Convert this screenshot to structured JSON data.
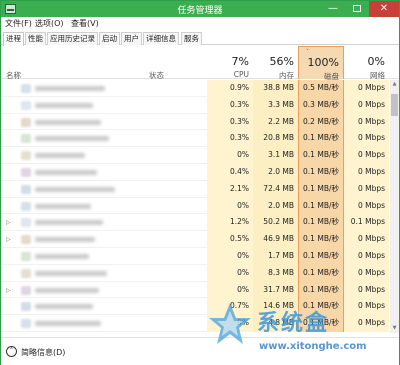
{
  "window": {
    "title": "任务管理器"
  },
  "window_controls": {
    "minimize": "—",
    "close": "✕"
  },
  "menu": {
    "items": [
      "文件(F)",
      "选项(O)",
      "查看(V)"
    ]
  },
  "tabs": [
    {
      "label": "进程",
      "active": true
    },
    {
      "label": "性能",
      "active": false
    },
    {
      "label": "应用历史记录",
      "active": false
    },
    {
      "label": "启动",
      "active": false
    },
    {
      "label": "用户",
      "active": false
    },
    {
      "label": "详细信息",
      "active": false
    },
    {
      "label": "服务",
      "active": false
    }
  ],
  "columns": {
    "name": "名称",
    "status": "状态",
    "cpu": {
      "percent": "7%",
      "label": "CPU"
    },
    "memory": {
      "percent": "56%",
      "label": "内存"
    },
    "disk": {
      "percent": "100%",
      "label": "磁盘"
    },
    "network": {
      "percent": "0%",
      "label": "网络"
    }
  },
  "rows": [
    {
      "expandable": false,
      "cpu": "0.9%",
      "memory": "38.8 MB",
      "disk": "0.5 MB/秒",
      "network": "0 Mbps"
    },
    {
      "expandable": false,
      "cpu": "0.3%",
      "memory": "3.3 MB",
      "disk": "0.3 MB/秒",
      "network": "0 Mbps"
    },
    {
      "expandable": false,
      "cpu": "0.3%",
      "memory": "2.2 MB",
      "disk": "0.2 MB/秒",
      "network": "0 Mbps"
    },
    {
      "expandable": false,
      "cpu": "0.3%",
      "memory": "20.8 MB",
      "disk": "0.1 MB/秒",
      "network": "0 Mbps"
    },
    {
      "expandable": false,
      "cpu": "0%",
      "memory": "3.1 MB",
      "disk": "0.1 MB/秒",
      "network": "0 Mbps"
    },
    {
      "expandable": false,
      "cpu": "0.4%",
      "memory": "2.0 MB",
      "disk": "0.1 MB/秒",
      "network": "0 Mbps"
    },
    {
      "expandable": false,
      "cpu": "2.1%",
      "memory": "72.4 MB",
      "disk": "0.1 MB/秒",
      "network": "0 Mbps"
    },
    {
      "expandable": false,
      "cpu": "0%",
      "memory": "2.0 MB",
      "disk": "0.1 MB/秒",
      "network": "0 Mbps"
    },
    {
      "expandable": true,
      "cpu": "1.2%",
      "memory": "50.2 MB",
      "disk": "0.1 MB/秒",
      "network": "0.1 Mbps"
    },
    {
      "expandable": true,
      "cpu": "0.5%",
      "memory": "46.9 MB",
      "disk": "0.1 MB/秒",
      "network": "0 Mbps"
    },
    {
      "expandable": false,
      "cpu": "0%",
      "memory": "1.7 MB",
      "disk": "0.1 MB/秒",
      "network": "0 Mbps"
    },
    {
      "expandable": false,
      "cpu": "0%",
      "memory": "8.3 MB",
      "disk": "0.1 MB/秒",
      "network": "0 Mbps"
    },
    {
      "expandable": true,
      "cpu": "0%",
      "memory": "31.7 MB",
      "disk": "0.1 MB/秒",
      "network": "0 Mbps"
    },
    {
      "expandable": false,
      "cpu": "0.7%",
      "memory": "14.6 MB",
      "disk": "0.1 MB/秒",
      "network": "0 Mbps"
    },
    {
      "expandable": false,
      "cpu": "0%",
      "memory": "4.8 MB",
      "disk": "0.1 MB/秒",
      "network": "0 Mbps"
    }
  ],
  "footer": {
    "fewer_details": "简略信息(D)"
  },
  "watermark": {
    "text": "系统盒",
    "url": "www.xitonghe.com"
  },
  "colors": {
    "titlebar": "#3cae52",
    "disk_highlight": "#f7d6a8",
    "cpu_column": "#fff4cf",
    "close_button": "#c7413a"
  }
}
